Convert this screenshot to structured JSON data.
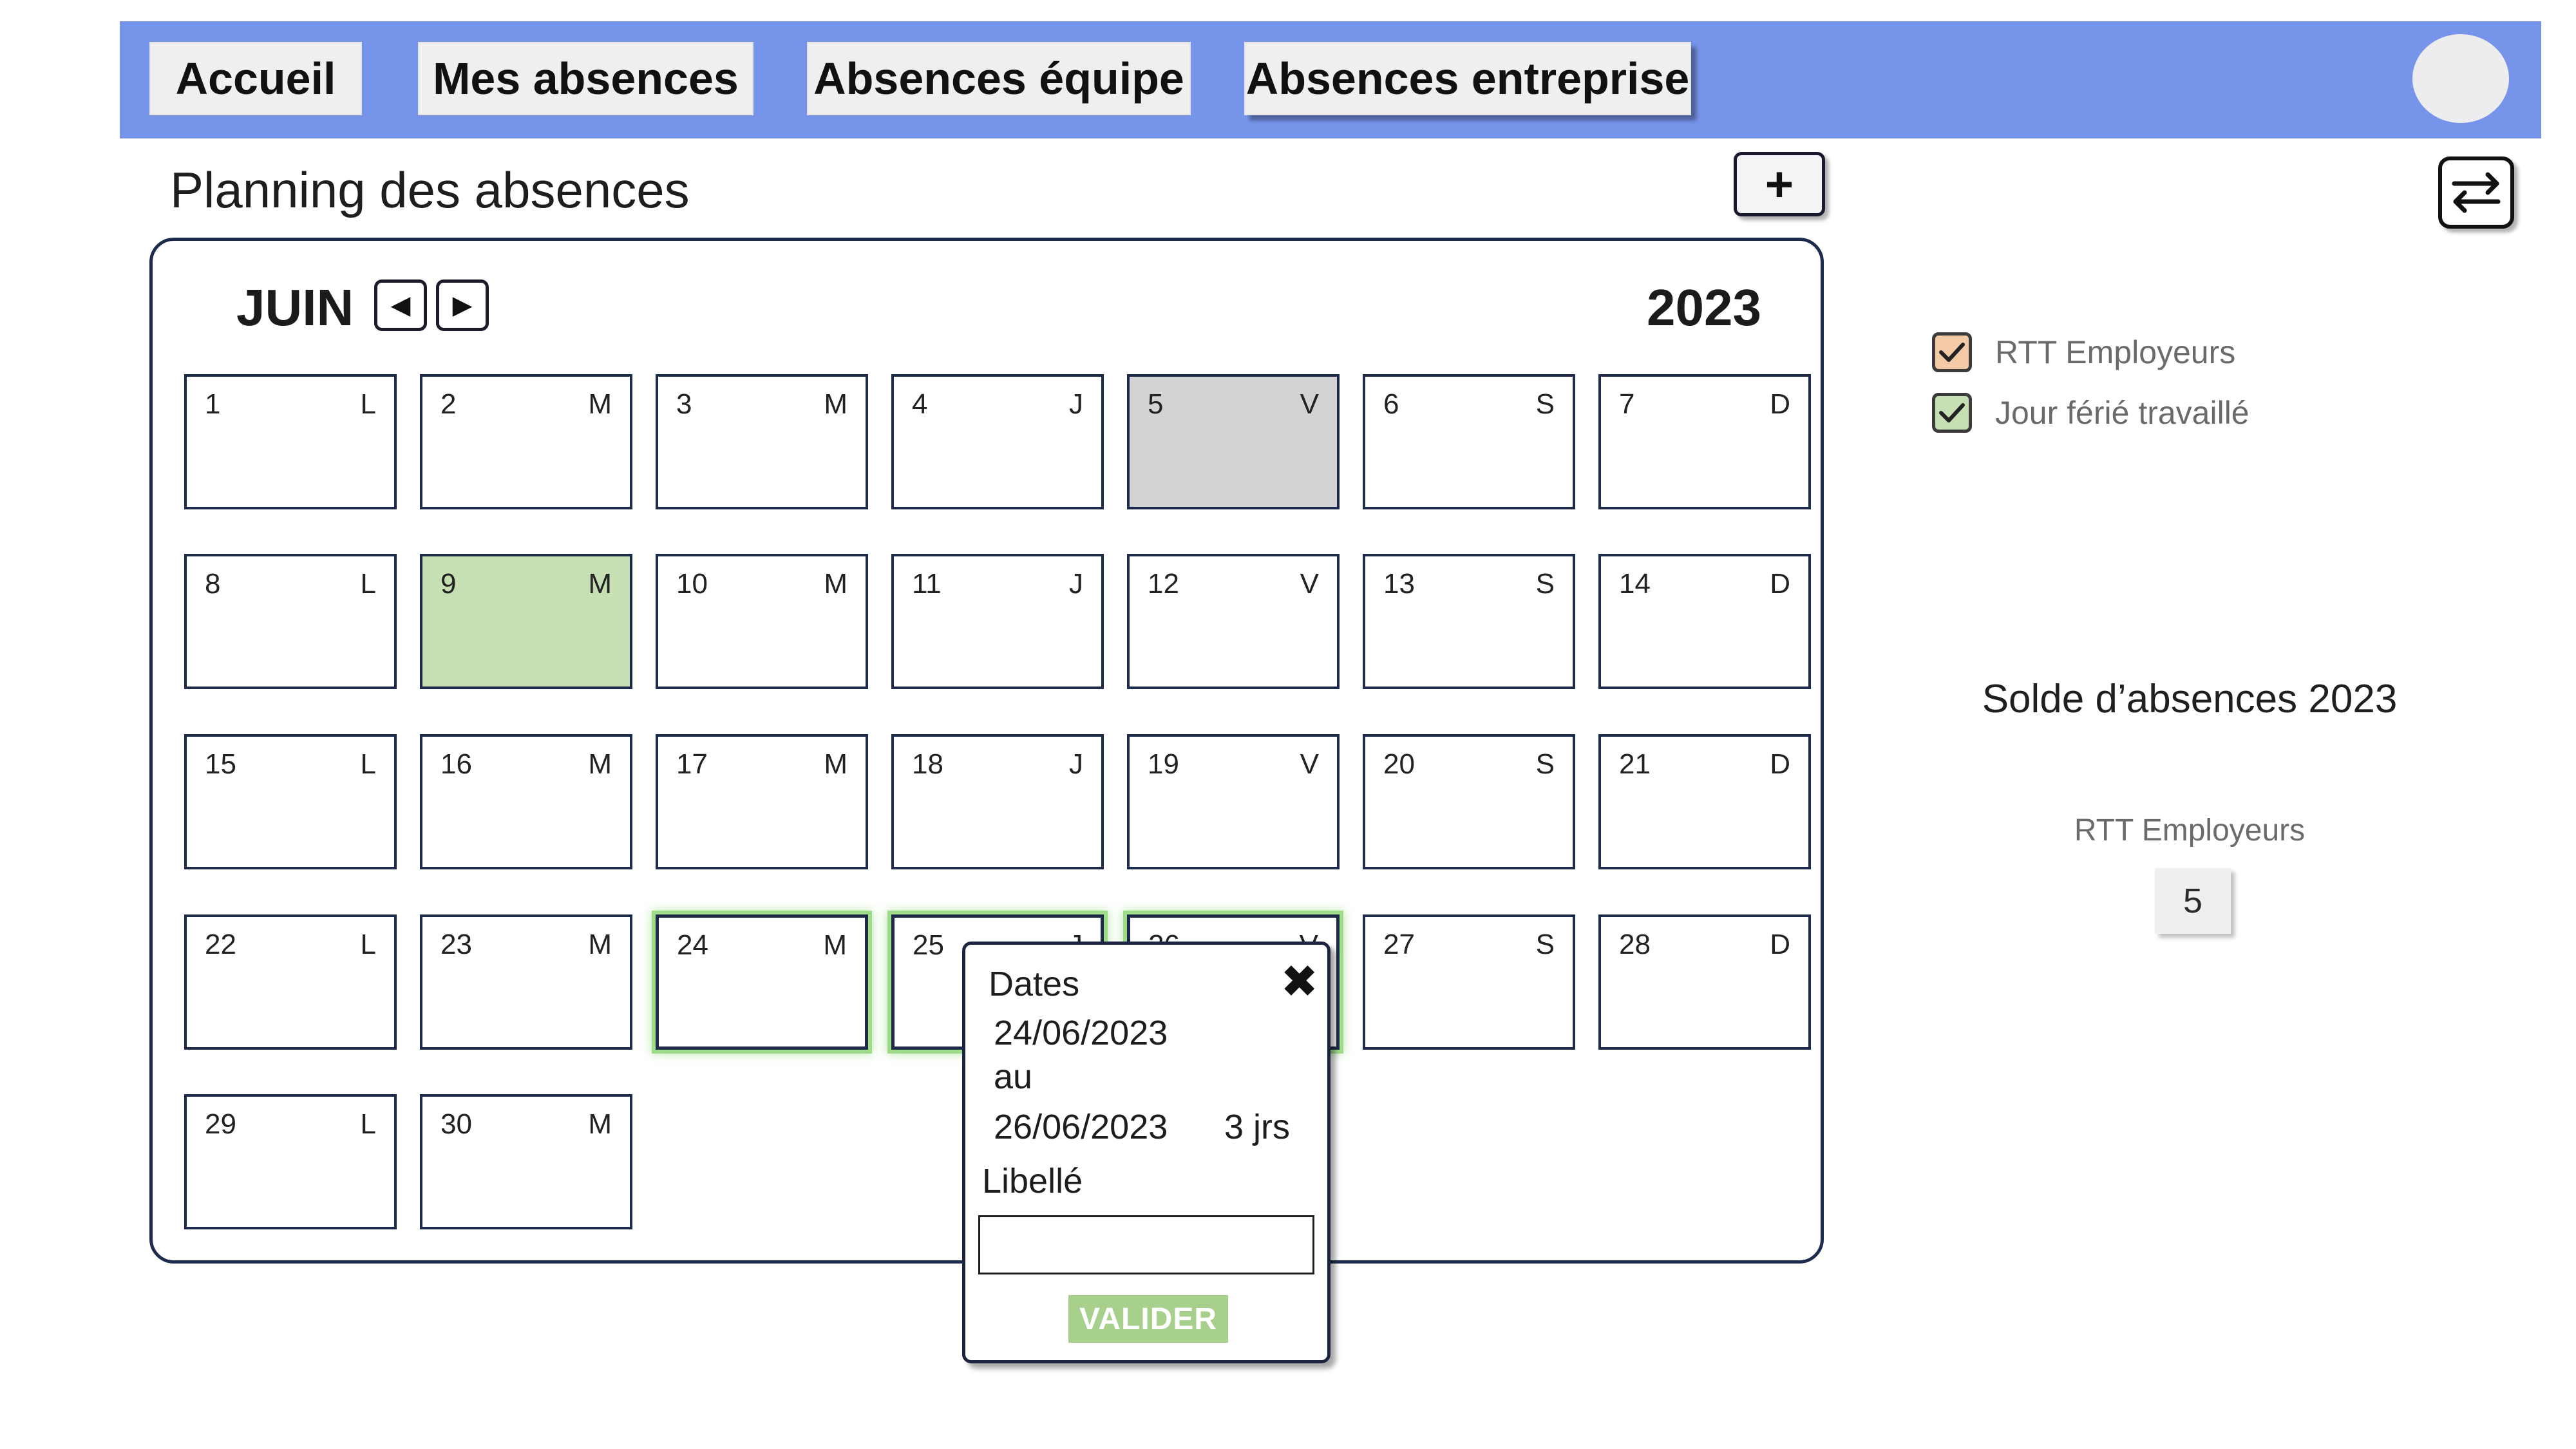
{
  "nav": {
    "tabs": [
      {
        "label": "Accueil"
      },
      {
        "label": "Mes absences"
      },
      {
        "label": "Absences équipe"
      },
      {
        "label": "Absences entreprise"
      }
    ]
  },
  "header": {
    "title": "Planning des absences",
    "add_label": "+"
  },
  "calendar": {
    "month": "JUIN",
    "year": "2023",
    "prev_icon": "◀",
    "next_icon": "▶",
    "days": [
      {
        "num": "1",
        "wd": "L"
      },
      {
        "num": "2",
        "wd": "M"
      },
      {
        "num": "3",
        "wd": "M"
      },
      {
        "num": "4",
        "wd": "J"
      },
      {
        "num": "5",
        "wd": "V",
        "state": "grey"
      },
      {
        "num": "6",
        "wd": "S"
      },
      {
        "num": "7",
        "wd": "D"
      },
      {
        "num": "8",
        "wd": "L"
      },
      {
        "num": "9",
        "wd": "M",
        "state": "green"
      },
      {
        "num": "10",
        "wd": "M"
      },
      {
        "num": "11",
        "wd": "J"
      },
      {
        "num": "12",
        "wd": "V"
      },
      {
        "num": "13",
        "wd": "S"
      },
      {
        "num": "14",
        "wd": "D"
      },
      {
        "num": "15",
        "wd": "L"
      },
      {
        "num": "16",
        "wd": "M"
      },
      {
        "num": "17",
        "wd": "M"
      },
      {
        "num": "18",
        "wd": "J"
      },
      {
        "num": "19",
        "wd": "V"
      },
      {
        "num": "20",
        "wd": "S"
      },
      {
        "num": "21",
        "wd": "D"
      },
      {
        "num": "22",
        "wd": "L"
      },
      {
        "num": "23",
        "wd": "M"
      },
      {
        "num": "24",
        "wd": "M",
        "state": "selected"
      },
      {
        "num": "25",
        "wd": "J",
        "state": "selected"
      },
      {
        "num": "26",
        "wd": "V",
        "state": "selected"
      },
      {
        "num": "27",
        "wd": "S"
      },
      {
        "num": "28",
        "wd": "D"
      },
      {
        "num": "29",
        "wd": "L"
      },
      {
        "num": "30",
        "wd": "M"
      }
    ]
  },
  "popup": {
    "dates_label": "Dates",
    "start_date": "24/06/2023",
    "to_label": "au",
    "end_date": "26/06/2023",
    "duration": "3 jrs",
    "libelle_label": "Libellé",
    "libelle_value": "",
    "submit_label": "VALIDER",
    "close_icon": "✖"
  },
  "legend": [
    {
      "label": "RTT Employeurs",
      "color": "#f4c9a5",
      "checked": true
    },
    {
      "label": "Jour férié travaillé",
      "color": "#c6e0b4",
      "checked": true
    }
  ],
  "balance": {
    "title": "Solde d’absences 2023",
    "label": "RTT Employeurs",
    "value": "5"
  },
  "colors": {
    "nav_bar": "#7694ea",
    "holiday_grey": "#d3d2d4",
    "worked_holiday_green": "#c6e0b4",
    "selection_glow": "#9fdc8a",
    "valider_green": "#a8d08d"
  }
}
